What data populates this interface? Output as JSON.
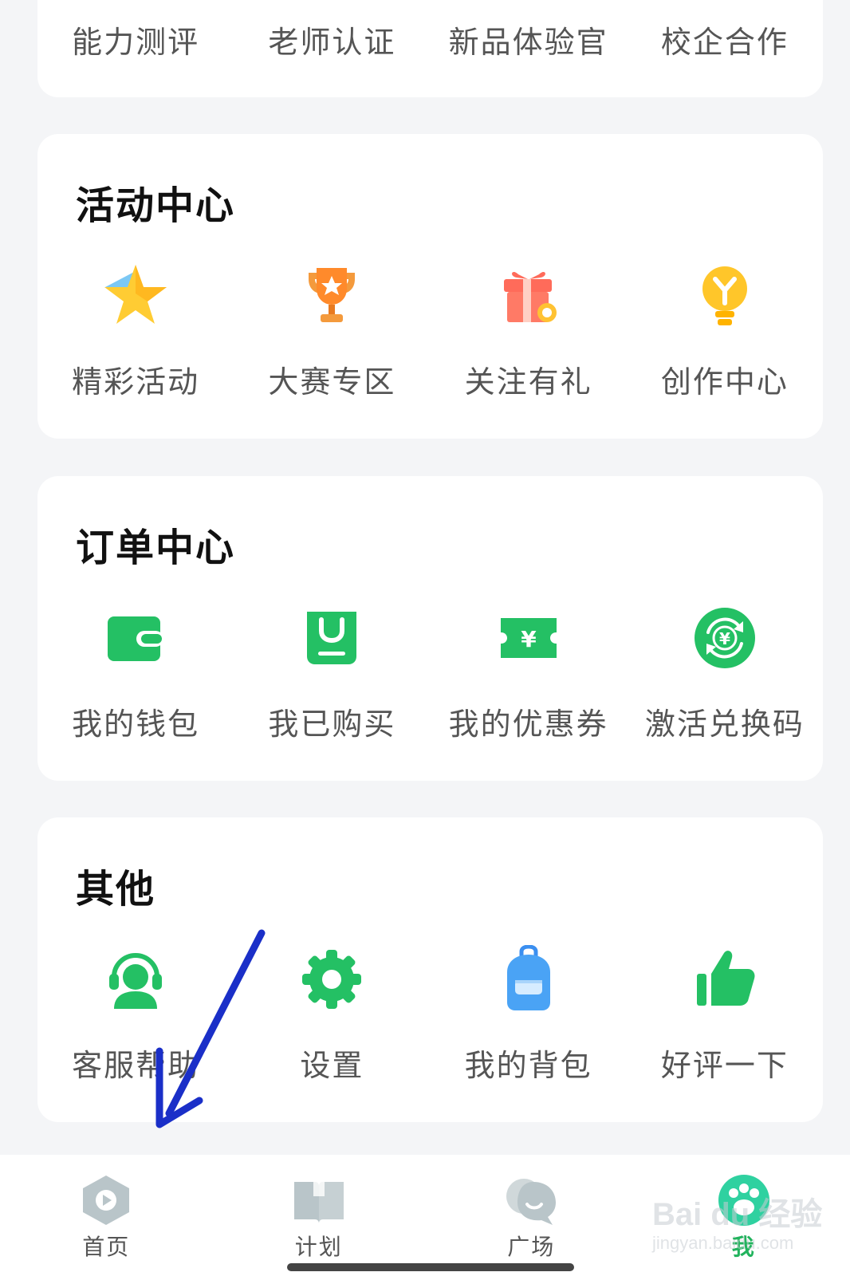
{
  "top_row": {
    "items": [
      "能力测评",
      "老师认证",
      "新品体验官",
      "校企合作"
    ]
  },
  "activity_center": {
    "title": "活动中心",
    "items": [
      {
        "label": "精彩活动",
        "icon": "star-icon"
      },
      {
        "label": "大赛专区",
        "icon": "trophy-icon"
      },
      {
        "label": "关注有礼",
        "icon": "gift-icon"
      },
      {
        "label": "创作中心",
        "icon": "lightbulb-icon"
      }
    ]
  },
  "order_center": {
    "title": "订单中心",
    "items": [
      {
        "label": "我的钱包",
        "icon": "wallet-icon"
      },
      {
        "label": "我已购买",
        "icon": "shopping-bag-icon"
      },
      {
        "label": "我的优惠券",
        "icon": "coupon-icon"
      },
      {
        "label": "激活兑换码",
        "icon": "exchange-code-icon"
      }
    ]
  },
  "other": {
    "title": "其他",
    "items": [
      {
        "label": "客服帮助",
        "icon": "customer-service-icon"
      },
      {
        "label": "设置",
        "icon": "gear-icon"
      },
      {
        "label": "我的背包",
        "icon": "backpack-icon"
      },
      {
        "label": "好评一下",
        "icon": "thumbs-up-icon"
      }
    ]
  },
  "bottom_nav": {
    "items": [
      {
        "label": "首页",
        "icon": "play-icon",
        "active": false
      },
      {
        "label": "计划",
        "icon": "book-icon",
        "active": false
      },
      {
        "label": "广场",
        "icon": "chat-bubble-icon",
        "active": false
      },
      {
        "label": "我",
        "icon": "paw-icon",
        "active": true
      }
    ]
  },
  "watermark": {
    "brand": "Bai du 经验",
    "site": "jingyan.baidu.com"
  },
  "colors": {
    "accent_green": "#22b35d",
    "annotation_blue": "#1a2fc8",
    "nav_gray": "#b9c5c9"
  }
}
